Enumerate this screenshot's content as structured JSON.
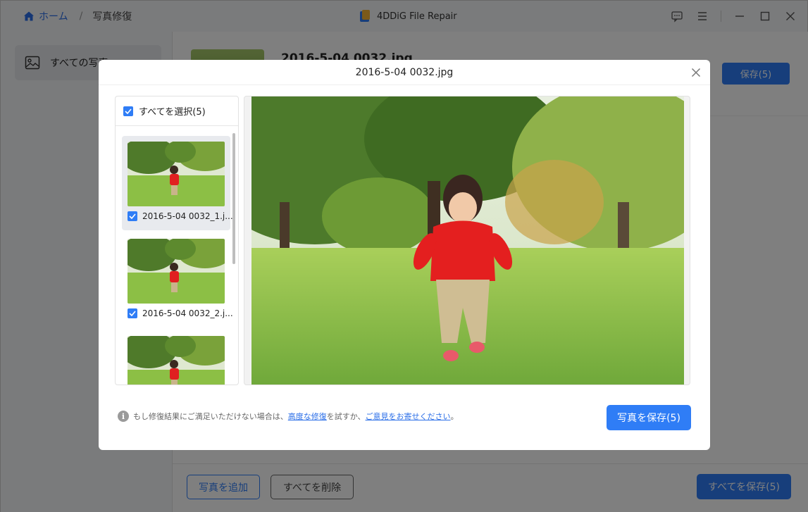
{
  "titlebar": {
    "home_label": "ホーム",
    "separator": "/",
    "current_label": "写真修復",
    "app_title": "4DDiG File Repair"
  },
  "sidebar": {
    "items": [
      {
        "label": "すべての写真",
        "icon": "image-icon"
      }
    ]
  },
  "main": {
    "file_name": "2016-5-04 0032.jpg",
    "save_label": "保存(5)",
    "add_photo_label": "写真を追加",
    "delete_all_label": "すべてを削除",
    "save_all_label": "すべてを保存(5)"
  },
  "modal": {
    "title": "2016-5-04 0032.jpg",
    "select_all_label": "すべてを選択(5)",
    "items": [
      {
        "name": "2016-5-04 0032_1.j...",
        "checked": true,
        "selected": true
      },
      {
        "name": "2016-5-04 0032_2.j...",
        "checked": true,
        "selected": false
      },
      {
        "name": "",
        "checked": true,
        "selected": false
      }
    ],
    "note_prefix": "もし修復結果にご満足いただけない場合は、",
    "note_link1": "高度な修復",
    "note_mid": "を試すか、",
    "note_link2": "ご意見をお寄せください",
    "note_suffix": "。",
    "save_button_label": "写真を保存(5)"
  },
  "colors": {
    "accent": "#2f7df6",
    "link": "#2a6ee8"
  }
}
